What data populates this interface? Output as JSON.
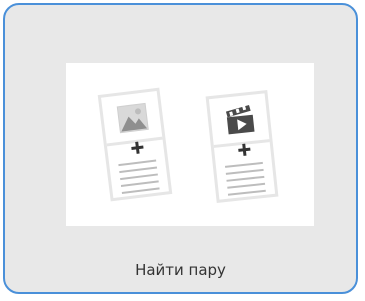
{
  "tile": {
    "label": "Найти пару",
    "accent_color": "#4a90d9",
    "icons": [
      "image-icon",
      "video-icon"
    ]
  }
}
